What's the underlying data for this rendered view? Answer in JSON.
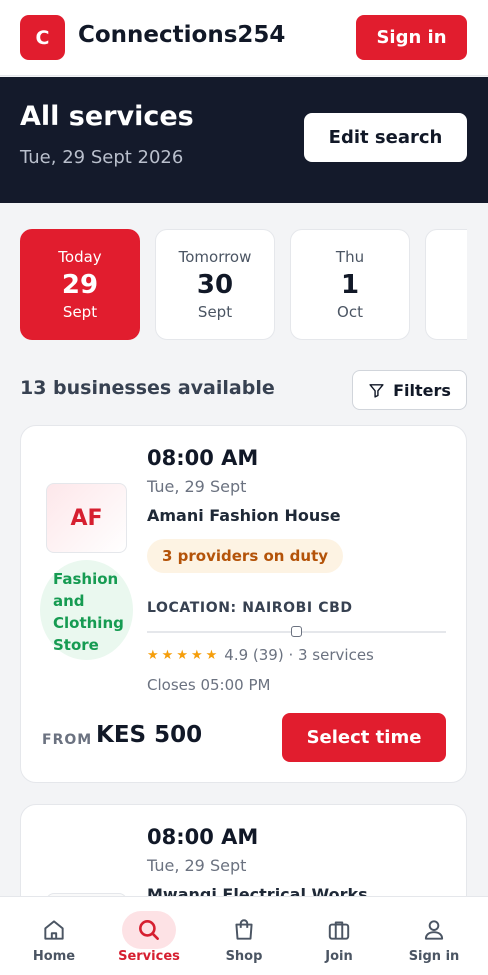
{
  "header": {
    "logo_letter": "C",
    "brand": "Connections254",
    "signin_label": "Sign in"
  },
  "hero": {
    "title": "All services",
    "date": "Tue, 29 Sept 2026",
    "edit_label": "Edit search"
  },
  "dates": [
    {
      "label": "Today",
      "day": "29",
      "month": "Sept",
      "selected": true
    },
    {
      "label": "Tomorrow",
      "day": "30",
      "month": "Sept",
      "selected": false
    },
    {
      "label": "Thu",
      "day": "1",
      "month": "Oct",
      "selected": false
    }
  ],
  "results": {
    "count_text": "13 businesses available",
    "filters_label": "Filters"
  },
  "businesses": [
    {
      "initials": "AF",
      "category": "Fashion and Clothing Store",
      "time": "08:00 AM",
      "date": "Tue, 29 Sept",
      "name": "Amani Fashion House",
      "providers": "3 providers on duty",
      "location": "LOCATION: NAIROBI CBD",
      "rating_stars": 5,
      "rating_text": "4.9 (39) · 3 services",
      "closes": "Closes 05:00 PM",
      "from_label": "FROM",
      "price": "KES 500",
      "select_label": "Select time"
    },
    {
      "time": "08:00 AM",
      "date": "Tue, 29 Sept",
      "name": "Mwangi Electrical Works"
    }
  ],
  "nav": [
    {
      "label": "Home",
      "icon": "home-icon",
      "active": false
    },
    {
      "label": "Services",
      "icon": "search-icon",
      "active": true
    },
    {
      "label": "Shop",
      "icon": "shopping-bag-icon",
      "active": false
    },
    {
      "label": "Join",
      "icon": "briefcase-icon",
      "active": false
    },
    {
      "label": "Sign in",
      "icon": "user-icon",
      "active": false
    }
  ],
  "colors": {
    "accent": "#e11d2e",
    "hero_bg": "#141a2b",
    "category_text": "#169b52",
    "providers_text": "#b45309",
    "star": "#f59e0b"
  }
}
